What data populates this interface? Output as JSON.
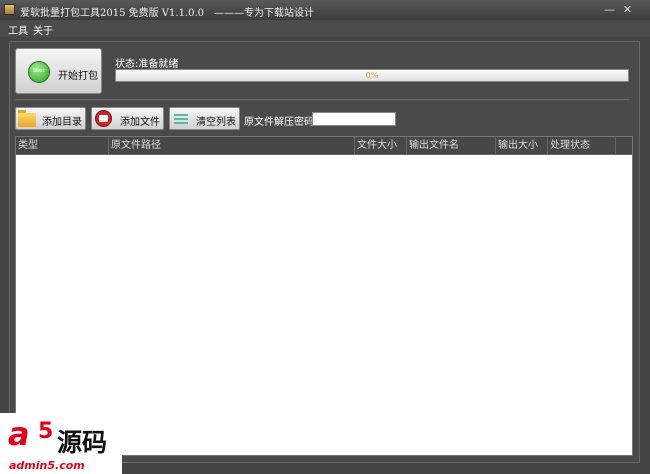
{
  "window": {
    "title": "爱软批量打包工具2015 免费版 V1.1.0.0　———专为下载站设计",
    "minimize": "—",
    "close": "✕",
    "app_icon": "package-icon"
  },
  "menu": {
    "items": [
      "工具",
      "关于"
    ]
  },
  "start_button": {
    "label": "开始打包",
    "icon": "start-icon",
    "icon_text": "Start"
  },
  "status": {
    "text": "状态:准备就绪"
  },
  "progress": {
    "value": 0,
    "text": "0%"
  },
  "toolbar": {
    "add_dir": "添加目录",
    "add_file": "添加文件",
    "clear_list": "清空列表",
    "password_label": "原文件解压密码",
    "password_value": ""
  },
  "list": {
    "columns": [
      "类型",
      "原文件路径",
      "文件大小",
      "输出文件名",
      "输出大小",
      "处理状态"
    ],
    "rows": []
  },
  "watermark": {
    "a": "a",
    "five": "5",
    "cn": "源码",
    "url": "admin5.com"
  }
}
